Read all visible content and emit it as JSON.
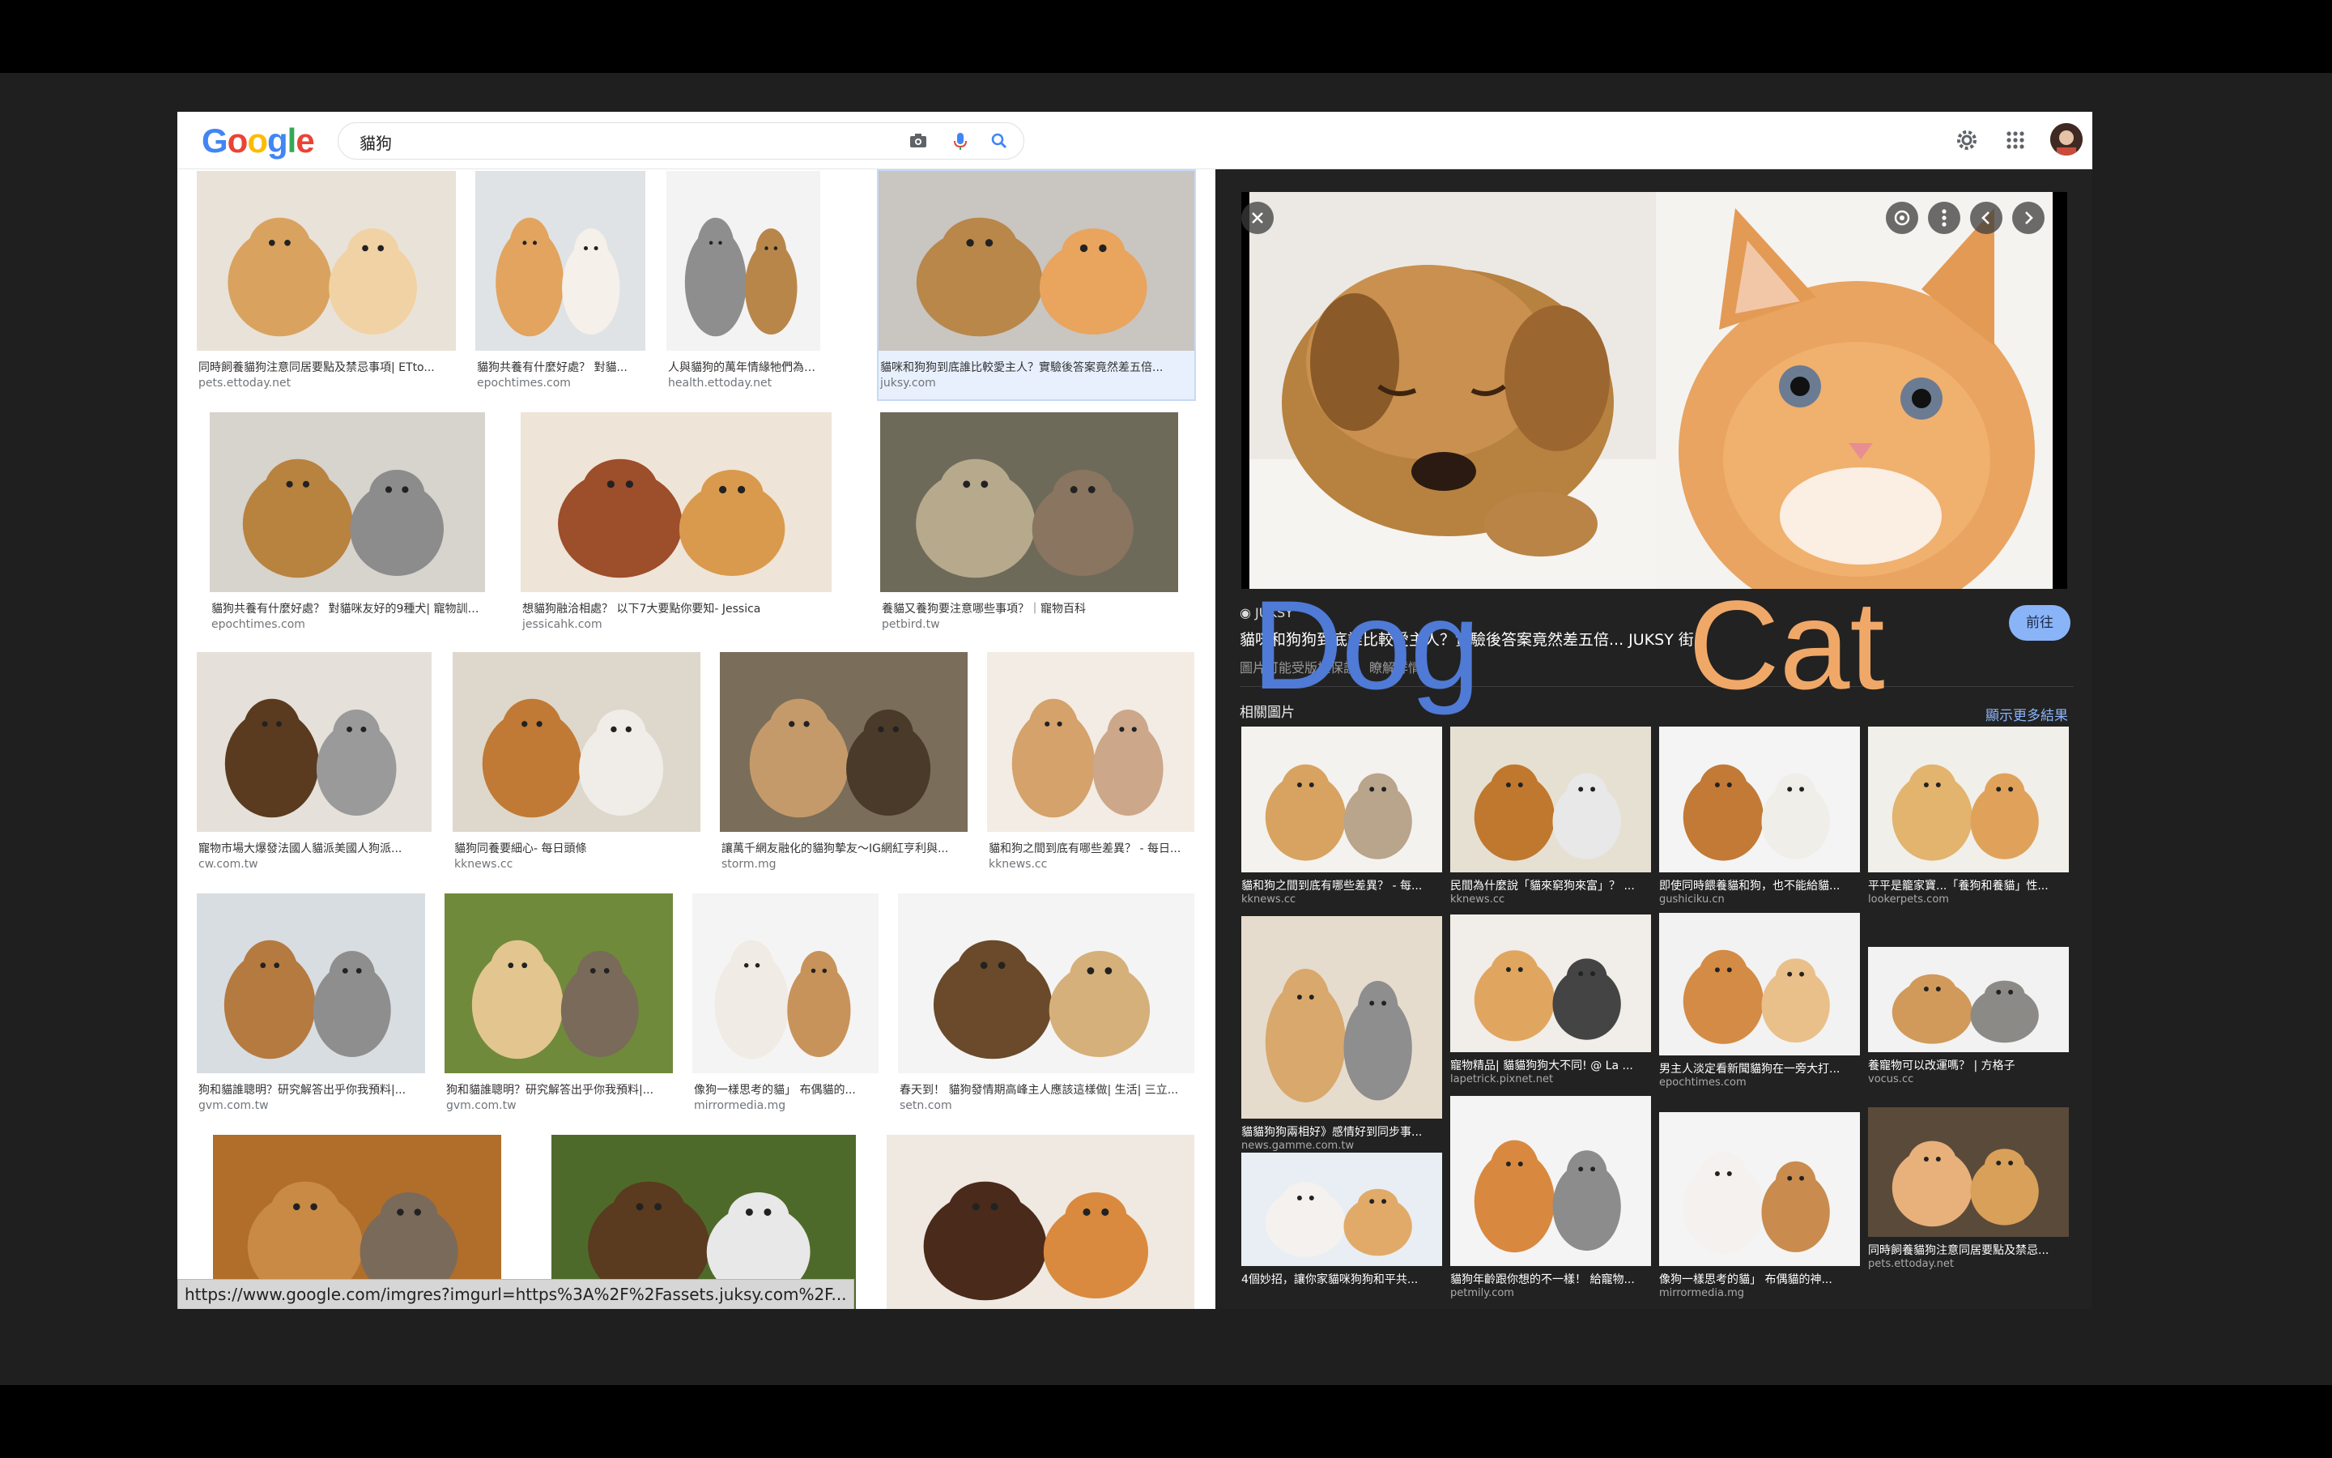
{
  "header": {
    "logo_letters": [
      {
        "ch": "G",
        "color": "#4285F4"
      },
      {
        "ch": "o",
        "color": "#EA4335"
      },
      {
        "ch": "o",
        "color": "#FBBC05"
      },
      {
        "ch": "g",
        "color": "#4285F4"
      },
      {
        "ch": "l",
        "color": "#34A853"
      },
      {
        "ch": "e",
        "color": "#EA4335"
      }
    ],
    "query": "貓狗"
  },
  "results": [
    {
      "title": "同時飼養貓狗注意同居要點及禁忌事項| ETto...",
      "source": "pets.ettoday.net"
    },
    {
      "title": "貓狗共養有什麼好處？ 對貓...",
      "source": "epochtimes.com"
    },
    {
      "title": "人與貓狗的萬年情緣牠們為何是...",
      "source": "health.ettoday.net"
    },
    {
      "title": "貓咪和狗狗到底誰比較愛主人？實驗後答案竟然差五倍...",
      "source": "juksy.com"
    },
    {
      "title": "貓狗共養有什麼好處？ 對貓咪友好的9種犬| 寵物訓練|...",
      "source": "epochtimes.com"
    },
    {
      "title": "想貓狗融洽相處？ 以下7大要點你要知- Jessica",
      "source": "jessicahk.com"
    },
    {
      "title": "養貓又養狗要注意哪些事項？｜寵物百科",
      "source": "petbird.tw"
    },
    {
      "title": "寵物市場大爆發法國人貓派美國人狗派...",
      "source": "cw.com.tw"
    },
    {
      "title": "貓狗同養要細心- 每日頭條",
      "source": "kknews.cc"
    },
    {
      "title": "讓萬千網友融化的貓狗摯友～IG網紅亨利與...",
      "source": "storm.mg"
    },
    {
      "title": "貓和狗之間到底有哪些差異？ - 每日...",
      "source": "kknews.cc"
    },
    {
      "title": "狗和貓誰聰明？研究解答出乎你我預料|...",
      "source": "gvm.com.tw"
    },
    {
      "title": "狗和貓誰聰明？研究解答出乎你我預料|...",
      "source": "gvm.com.tw"
    },
    {
      "title": "像狗一樣思考的貓」 布偶貓的...",
      "source": "mirrormedia.mg"
    },
    {
      "title": "春天到！ 貓狗發情期高峰主人應該這樣做| 生活| 三立...",
      "source": "setn.com"
    },
    {
      "title": "",
      "source": ""
    },
    {
      "title": "",
      "source": ""
    },
    {
      "title": "",
      "source": ""
    }
  ],
  "panel": {
    "source": "JUKSY",
    "title": "貓咪和狗狗到底誰比較愛主人？實驗後答案竟然差五倍... JUKSY 街星",
    "subtitle": "圖片可能受版權保護。瞭解詳情",
    "visit_label": "前往",
    "related_heading": "相關圖片",
    "more_label": "顯示更多結果",
    "related": [
      {
        "title": "貓和狗之間到底有哪些差異？ - 每...",
        "source": "kknews.cc"
      },
      {
        "title": "民間為什麼說「貓來窮狗來富」？ ...",
        "source": "kknews.cc"
      },
      {
        "title": "即使同時餵養貓和狗，也不能給貓...",
        "source": "gushiciku.cn"
      },
      {
        "title": "平平是籠家寶...「養狗和養貓」性...",
        "source": "lookerpets.com"
      },
      {
        "title": "貓貓狗狗兩相好》感情好到同步事...",
        "source": "news.gamme.com.tw"
      },
      {
        "title": "寵物精品| 貓貓狗狗大不同! @ La ...",
        "source": "lapetrick.pixnet.net"
      },
      {
        "title": "男主人淡定看新聞貓狗在一旁大打...",
        "source": "epochtimes.com"
      },
      {
        "title": "養寵物可以改運嗎？ | 方格子",
        "source": "vocus.cc"
      },
      {
        "title": "4個妙招，讓你家貓咪狗狗和平共...",
        "source": ""
      },
      {
        "title": "貓狗年齡跟你想的不一樣！ 給寵物...",
        "source": "petmily.com"
      },
      {
        "title": "像狗一樣思考的貓」 布偶貓的神...",
        "source": "mirrormedia.mg"
      },
      {
        "title": "同時飼養貓狗注意同居要點及禁忌...",
        "source": "pets.ettoday.net"
      }
    ]
  },
  "overlay": {
    "dog": "Dog",
    "cat": "Cat"
  },
  "status_url": "https://www.google.com/imgres?imgurl=https%3A%2F%2Fassets.juksy.com%2F..."
}
